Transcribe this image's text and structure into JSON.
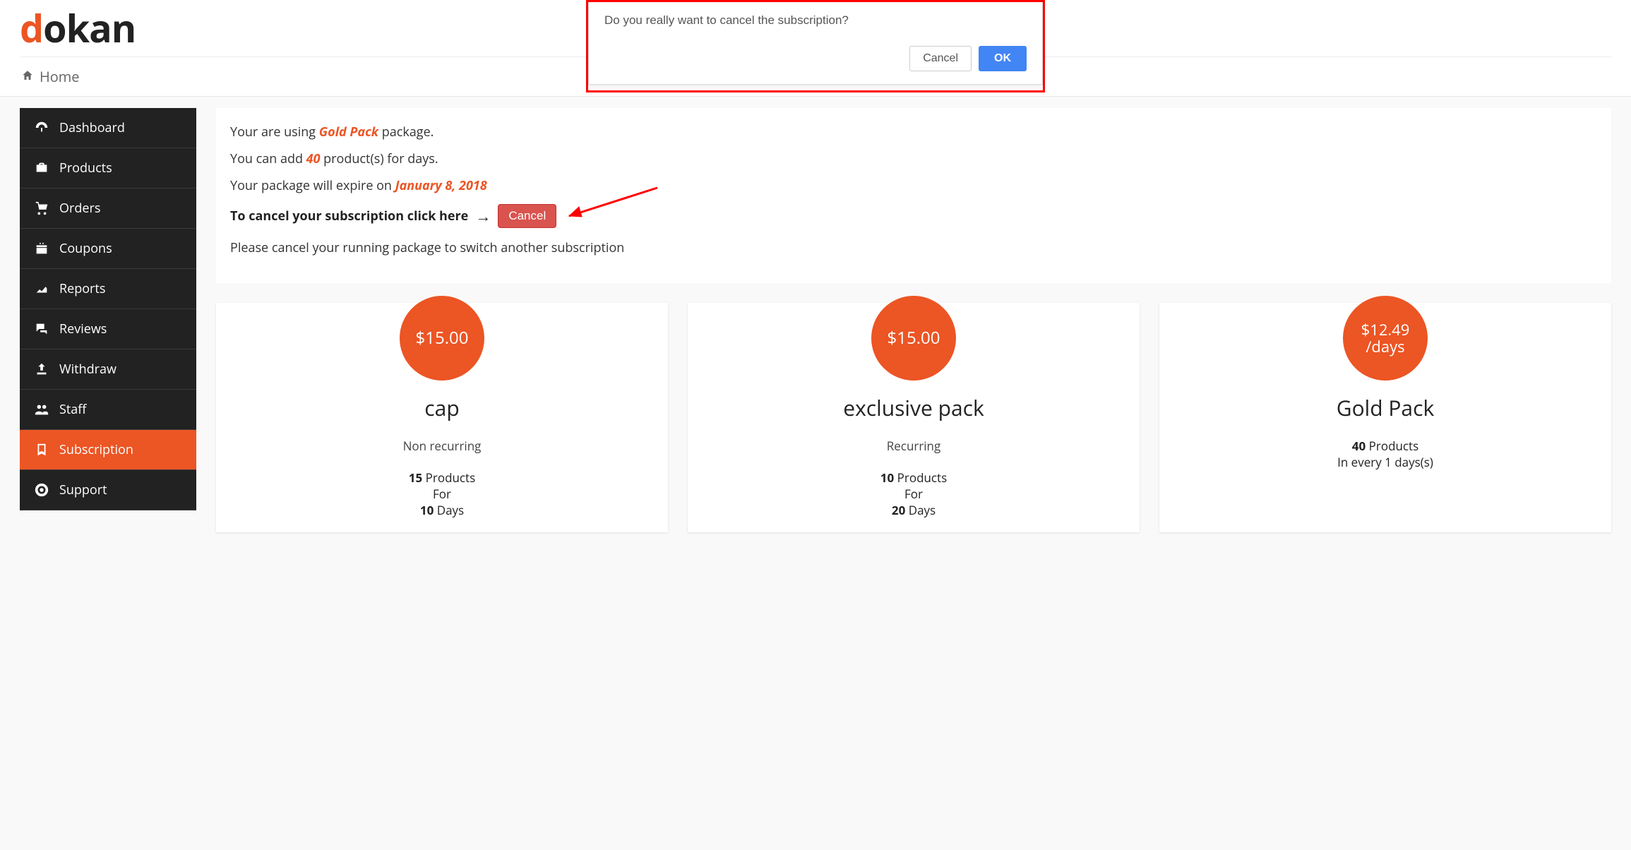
{
  "brand": {
    "d": "d",
    "rest": "okan"
  },
  "breadcrumb": {
    "label": "Home"
  },
  "dialog": {
    "message": "Do you really want to cancel the subscription?",
    "cancel": "Cancel",
    "ok": "OK"
  },
  "sidebar": {
    "items": [
      {
        "label": "Dashboard"
      },
      {
        "label": "Products"
      },
      {
        "label": "Orders"
      },
      {
        "label": "Coupons"
      },
      {
        "label": "Reports"
      },
      {
        "label": "Reviews"
      },
      {
        "label": "Withdraw"
      },
      {
        "label": "Staff"
      },
      {
        "label": "Subscription"
      },
      {
        "label": "Support"
      }
    ]
  },
  "info": {
    "using_prefix": "Your are using ",
    "using_pack": "Gold Pack",
    "using_suffix": " package.",
    "can_add_prefix": "You can add ",
    "can_add_num": "40",
    "can_add_suffix": " product(s) for days.",
    "expire_prefix": "Your package will expire on ",
    "expire_date": "January 8, 2018",
    "cancel_label": "To cancel your subscription click here",
    "cancel_arrow": "→",
    "cancel_btn": "Cancel",
    "switch_note": "Please cancel your running package to switch another subscription"
  },
  "packs": [
    {
      "price": "$15.00",
      "name": "cap",
      "sub": "Non recurring",
      "products_num": "15",
      "products_word": " Products",
      "for": "For",
      "days_num": "10",
      "days_word": " Days"
    },
    {
      "price": "$15.00",
      "name": "exclusive pack",
      "sub": "Recurring",
      "products_num": "10",
      "products_word": " Products",
      "for": "For",
      "days_num": "20",
      "days_word": " Days"
    },
    {
      "price": "$12.49 /days",
      "name": "Gold Pack",
      "sub": "",
      "products_num": "40",
      "products_word": " Products",
      "for": "In every 1 days(s)",
      "days_num": "",
      "days_word": ""
    }
  ]
}
